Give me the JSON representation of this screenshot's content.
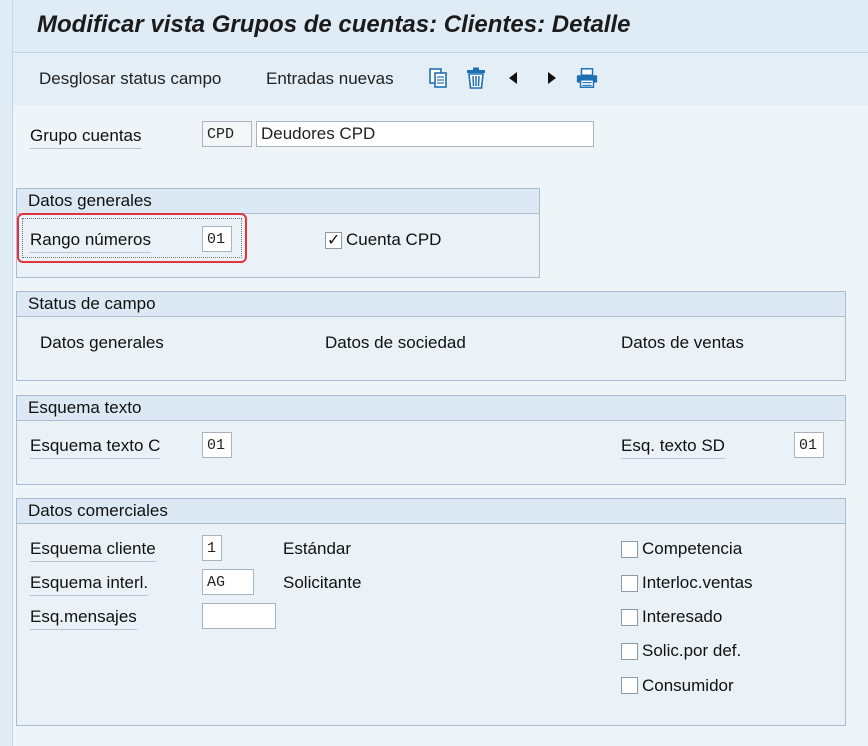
{
  "window": {
    "title": "Modificar vista Grupos de cuentas: Clientes: Detalle"
  },
  "toolbar": {
    "field_status_label": "Desglosar status campo",
    "new_entries_label": "Entradas nuevas",
    "icons": [
      "copy-icon",
      "delete-icon",
      "previous-icon",
      "next-icon",
      "print-icon"
    ]
  },
  "header": {
    "account_group_label": "Grupo cuentas",
    "account_group_code": "CPD",
    "account_group_desc": "Deudores CPD"
  },
  "datos_generales": {
    "title": "Datos generales",
    "number_range_label": "Rango números",
    "number_range_value": "01",
    "cpd_label": "Cuenta CPD",
    "cpd_checked": true
  },
  "status_campo": {
    "title": "Status de campo",
    "general_label": "Datos generales",
    "company_label": "Datos de sociedad",
    "sales_label": "Datos de ventas"
  },
  "esquema_texto": {
    "title": "Esquema texto",
    "text_schema_c_label": "Esquema texto C",
    "text_schema_c_value": "01",
    "text_schema_sd_label": "Esq. texto SD",
    "text_schema_sd_value": "01"
  },
  "datos_comerciales": {
    "title": "Datos comerciales",
    "customer_schema_label": "Esquema cliente",
    "customer_schema_value": "1",
    "customer_schema_desc": "Estándar",
    "partner_schema_label": "Esquema interl.",
    "partner_schema_value": "AG",
    "partner_schema_desc": "Solicitante",
    "message_schema_label": "Esq.mensajes",
    "message_schema_value": "",
    "checkboxes": [
      {
        "label": "Competencia",
        "checked": false
      },
      {
        "label": "Interloc.ventas",
        "checked": false
      },
      {
        "label": "Interesado",
        "checked": false
      },
      {
        "label": "Solic.por def.",
        "checked": false
      },
      {
        "label": "Consumidor",
        "checked": false
      }
    ]
  },
  "colors": {
    "highlight": "#e0343c",
    "toolbar_icon": "#1f6fb5",
    "background": "#dfebf5"
  }
}
